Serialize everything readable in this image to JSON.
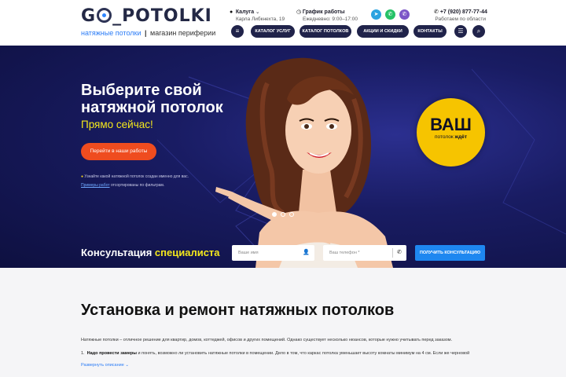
{
  "logo": {
    "name": "G_POTOLKI",
    "name_before_o": "G",
    "name_after_o": "_POTOLKI",
    "sub_left": "натяжные потолки",
    "sub_sep": "|",
    "sub_right": "магазин периферии"
  },
  "header": {
    "city": "Калуга",
    "address": "Карла Либкнехта, 19",
    "schedule_title": "График работы",
    "schedule_hours": "Ежедневно: 9:00–17:00",
    "phone": "+7 (920) 877-77-44",
    "phone_note": "Работаем по области"
  },
  "nav": {
    "items": [
      "КАТАЛОГ УСЛУГ",
      "КАТАЛОГ ПОТОЛКОВ",
      "АКЦИИ И СКИДКИ",
      "КОНТАКТЫ"
    ]
  },
  "hero": {
    "title_line1": "Выберите свой",
    "title_line2": "натяжной потолок",
    "subtitle": "Прямо сейчас!",
    "cta": "Перейти в наши работы",
    "note1": "Узнайте какой натяжной потолок создан именно для вас.",
    "note2_link": "Примеры работ",
    "note2_rest": "отсортированы по фильтрам.",
    "badge_big": "ВАШ",
    "badge_small_a": "потолок",
    "badge_small_b": "ждёт"
  },
  "consult": {
    "title_a": "Консультация",
    "title_b": "специалиста",
    "name_placeholder": "Ваше имя",
    "phone_placeholder": "Ваш телефон *",
    "button": "ПОЛУЧИТЬ КОНСУЛЬТАЦИЮ"
  },
  "content": {
    "title": "Установка и ремонт натяжных потолков",
    "paragraph": "Натяжные потолки – отличное решение для квартир, домов, коттеджей, офисов и других помещений. Однако существует несколько нюансов, которые нужно учитывать перед заказом.",
    "li_num": "1.",
    "li_bold": "Надо провести замеры",
    "li_rest": "и понять, возможно ли установить натяжные потолки в помещении. Дело в том, что каркас потолка уменьшает высоту комнаты минимум на 4 см. Если же черновой",
    "more": "Развернуть описание"
  },
  "colors": {
    "navy": "#20234a",
    "accent_blue": "#1e87f0",
    "cta_orange": "#ef4c1f",
    "yellow": "#f4e81c",
    "badge_yellow": "#f6c400"
  },
  "icons": [
    "map-pin-icon",
    "clock-icon",
    "telegram-icon",
    "whatsapp-icon",
    "viber-icon",
    "phone-icon",
    "menu-icon",
    "search-icon",
    "user-icon",
    "chevron-down-icon"
  ]
}
